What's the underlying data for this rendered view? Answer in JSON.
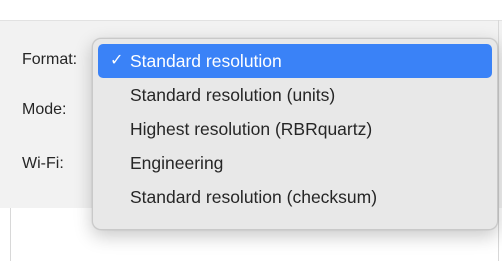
{
  "form": {
    "labels": {
      "format": "Format:",
      "mode": "Mode:",
      "wifi": "Wi-Fi:"
    }
  },
  "format_menu": {
    "check_glyph": "✓",
    "selected_index": 0,
    "accent_color": "#3a82f7",
    "items": [
      {
        "label": "Standard resolution"
      },
      {
        "label": "Standard resolution (units)"
      },
      {
        "label": "Highest resolution (RBRquartz)"
      },
      {
        "label": "Engineering"
      },
      {
        "label": "Standard resolution (checksum)"
      }
    ]
  }
}
